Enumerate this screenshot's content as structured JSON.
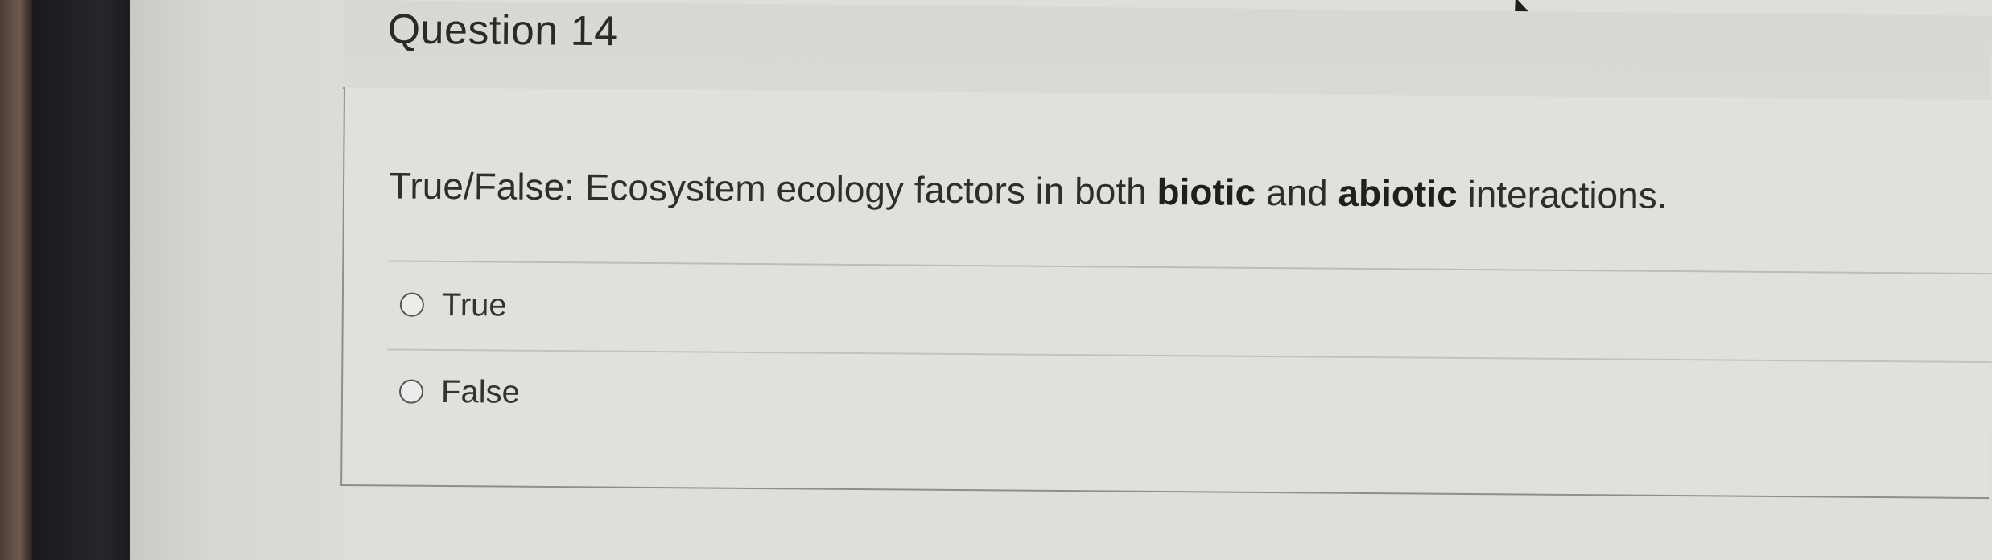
{
  "question": {
    "title": "Question 14",
    "prompt_prefix": "True/False: Ecosystem ecology factors in both ",
    "prompt_bold1": "biotic",
    "prompt_mid": " and ",
    "prompt_bold2": "abiotic",
    "prompt_suffix": " interactions."
  },
  "options": [
    {
      "label": "True",
      "selected": false
    },
    {
      "label": "False",
      "selected": false
    }
  ],
  "icons": {
    "cursor": "mouse-pointer-icon",
    "radio": "radio-button-icon"
  },
  "colors": {
    "page_background": "#dfdfda",
    "text": "#2e2e2e",
    "divider": "#bdbdb8"
  }
}
